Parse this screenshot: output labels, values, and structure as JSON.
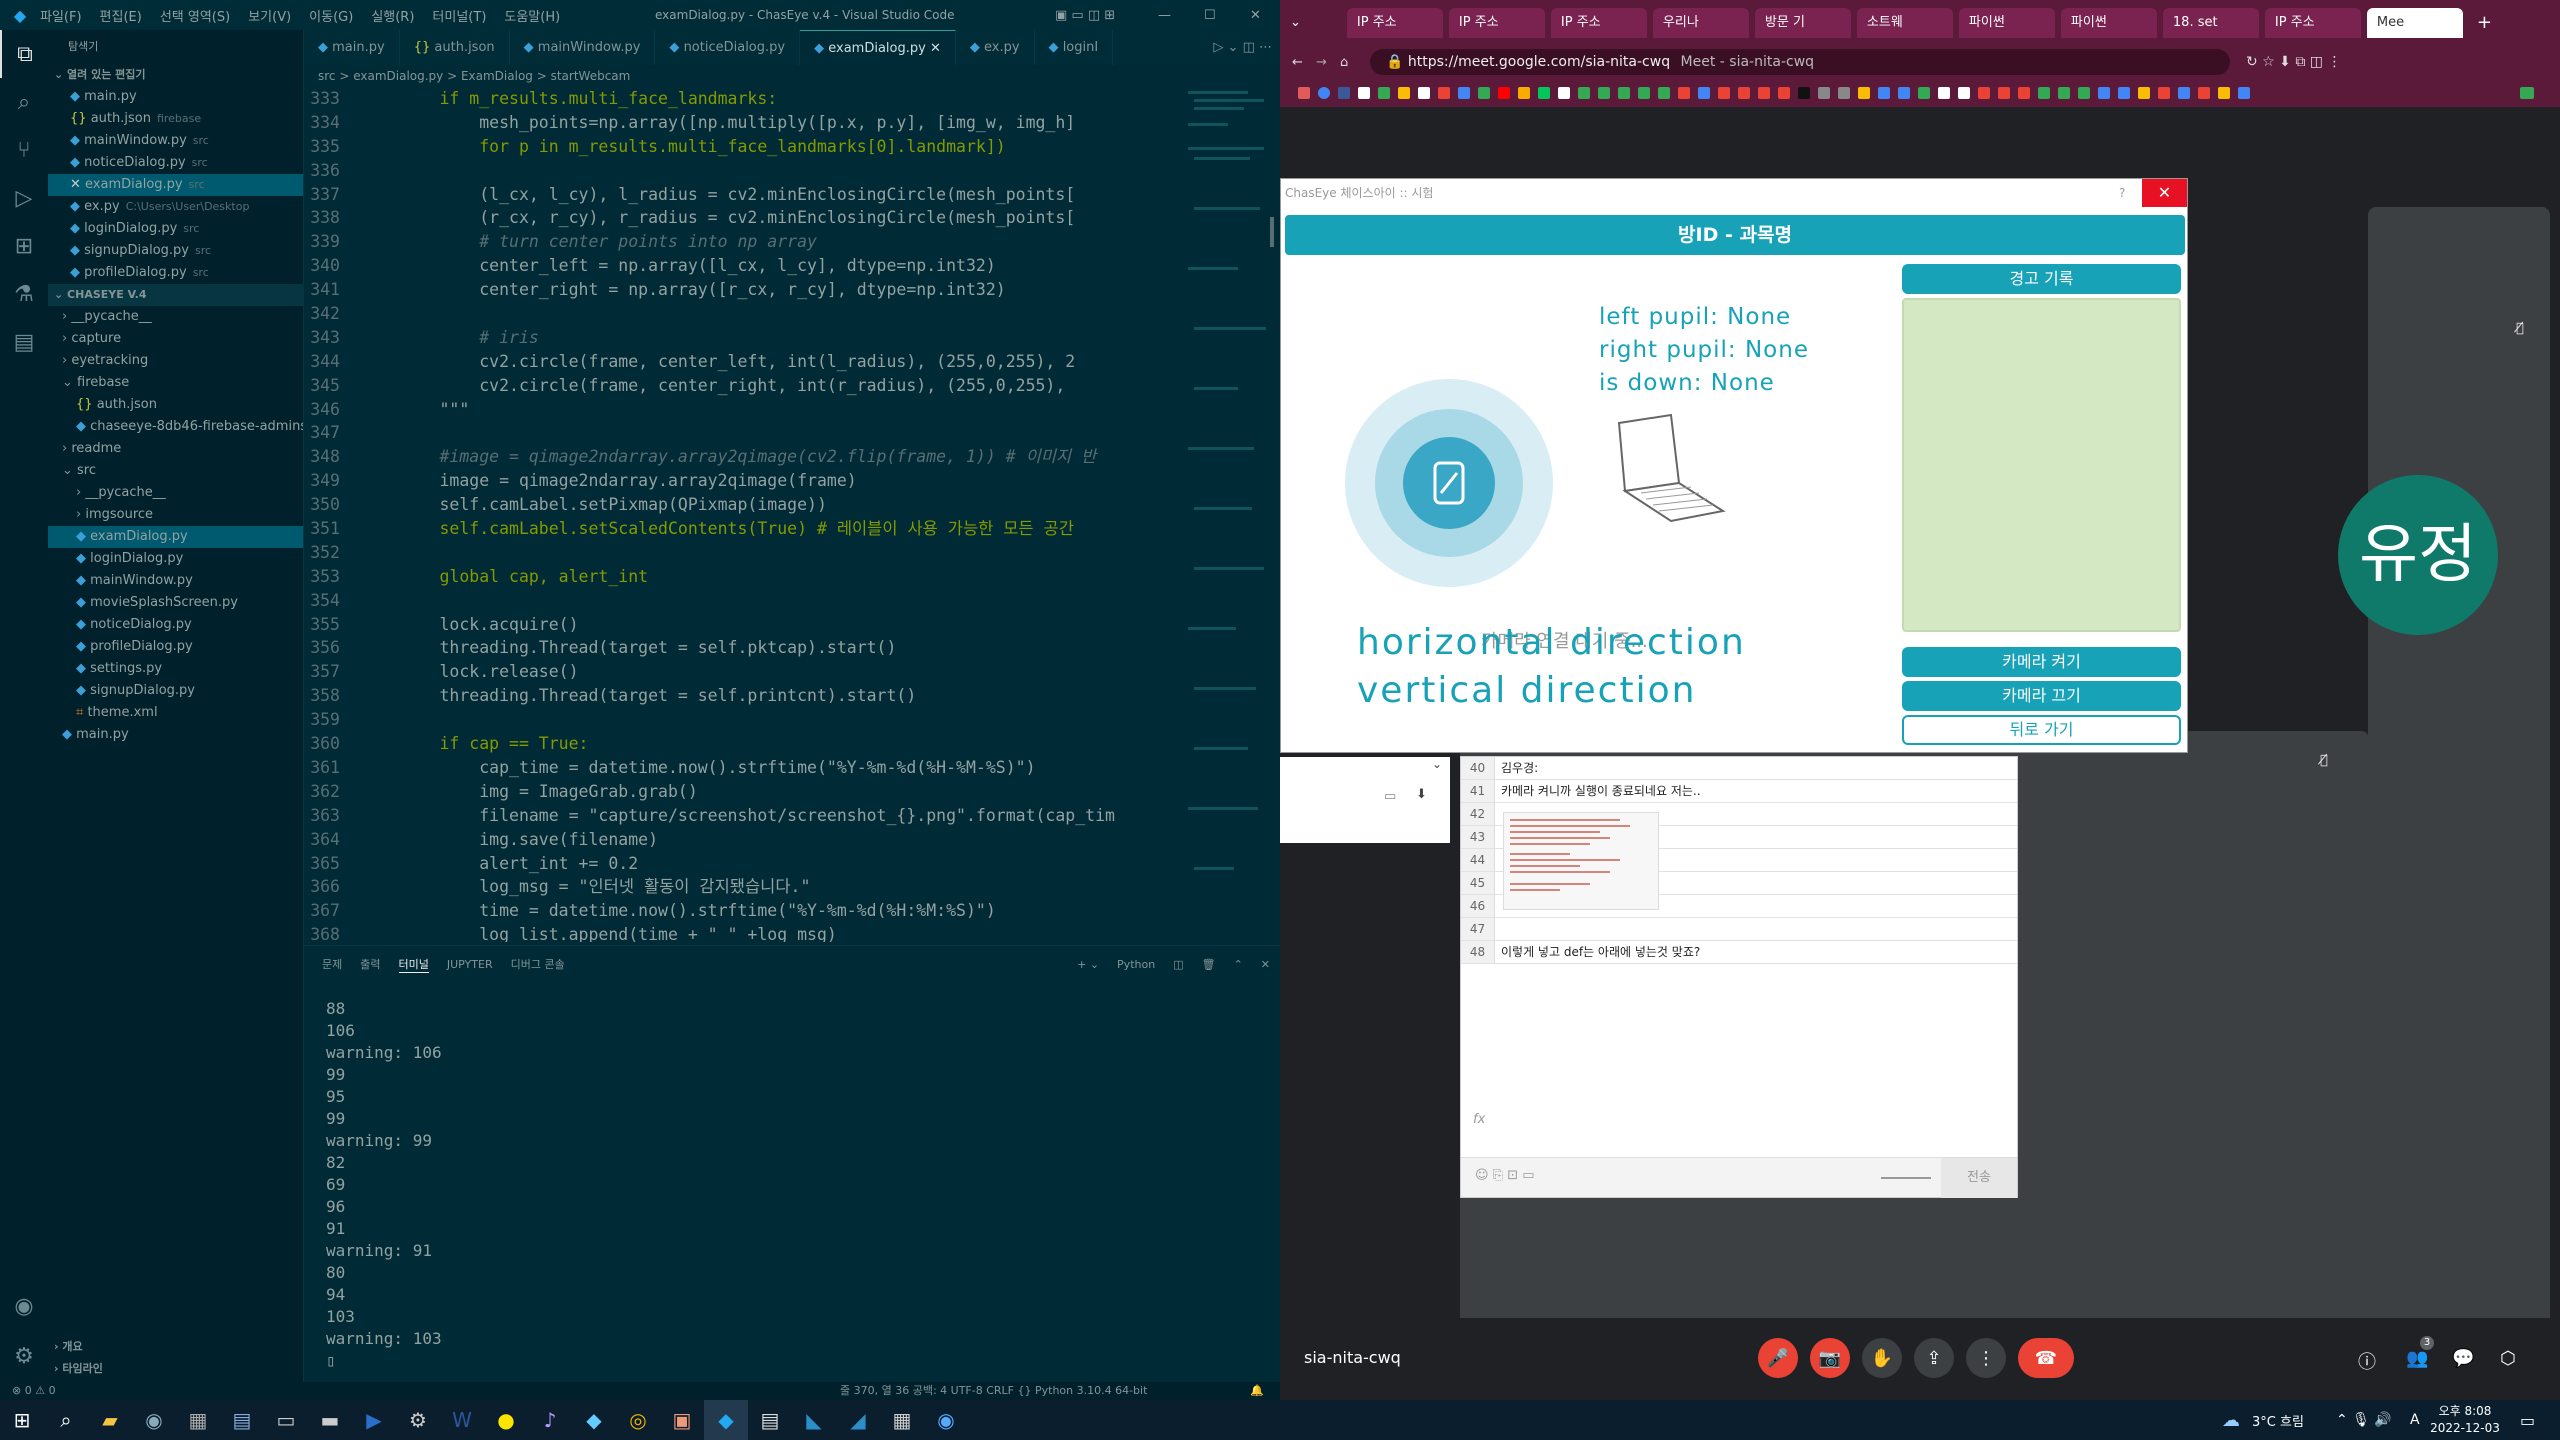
{
  "vscode": {
    "title": "examDialog.py - ChasEye v.4 - Visual Studio Code",
    "menu": [
      "파일(F)",
      "편집(E)",
      "선택 영역(S)",
      "보기(V)",
      "이동(G)",
      "실행(R)",
      "터미널(T)",
      "도움말(H)"
    ],
    "explorer_title": "탐색기",
    "open_editors_label": "열려 있는 편집기",
    "open_editors": [
      {
        "name": "main.py",
        "path": ""
      },
      {
        "name": "auth.json",
        "path": "firebase"
      },
      {
        "name": "mainWindow.py",
        "path": "src"
      },
      {
        "name": "noticeDialog.py",
        "path": "src"
      },
      {
        "name": "examDialog.py",
        "path": "src"
      },
      {
        "name": "ex.py",
        "path": "C:\\Users\\User\\Desktop"
      },
      {
        "name": "loginDialog.py",
        "path": "src"
      },
      {
        "name": "signupDialog.py",
        "path": "src"
      },
      {
        "name": "profileDialog.py",
        "path": "src"
      }
    ],
    "project_label": "CHASEYE V.4",
    "tree": [
      "__pycache__",
      "capture",
      "eyetracking",
      "firebase",
      "auth.json",
      "chaseeye-8db46-firebase-adminsd...",
      "readme",
      "src",
      "__pycache__",
      "imgsource",
      "examDialog.py",
      "loginDialog.py",
      "mainWindow.py",
      "movieSplashScreen.py",
      "noticeDialog.py",
      "profileDialog.py",
      "settings.py",
      "signupDialog.py",
      "theme.xml",
      "main.py"
    ],
    "outline_label": "개요",
    "timeline_label": "타임라인",
    "tabs": [
      "main.py",
      "auth.json",
      "mainWindow.py",
      "noticeDialog.py",
      "examDialog.py",
      "ex.py",
      "loginI"
    ],
    "breadcrumb": "src > examDialog.py > ExamDialog > startWebcam",
    "code": [
      {
        "n": "333",
        "t": "        if m_results.multi_face_landmarks:"
      },
      {
        "n": "334",
        "t": "            mesh_points=np.array([np.multiply([p.x, p.y], [img_w, img_h]"
      },
      {
        "n": "335",
        "t": "            for p in m_results.multi_face_landmarks[0].landmark])"
      },
      {
        "n": "336",
        "t": ""
      },
      {
        "n": "337",
        "t": "            (l_cx, l_cy), l_radius = cv2.minEnclosingCircle(mesh_points["
      },
      {
        "n": "338",
        "t": "            (r_cx, r_cy), r_radius = cv2.minEnclosingCircle(mesh_points["
      },
      {
        "n": "339",
        "t": "            # turn center points into np array"
      },
      {
        "n": "340",
        "t": "            center_left = np.array([l_cx, l_cy], dtype=np.int32)"
      },
      {
        "n": "341",
        "t": "            center_right = np.array([r_cx, r_cy], dtype=np.int32)"
      },
      {
        "n": "342",
        "t": ""
      },
      {
        "n": "343",
        "t": "            # iris"
      },
      {
        "n": "344",
        "t": "            cv2.circle(frame, center_left, int(l_radius), (255,0,255), 2"
      },
      {
        "n": "345",
        "t": "            cv2.circle(frame, center_right, int(r_radius), (255,0,255),"
      },
      {
        "n": "346",
        "t": "        \"\"\""
      },
      {
        "n": "347",
        "t": ""
      },
      {
        "n": "348",
        "t": "        #image = qimage2ndarray.array2qimage(cv2.flip(frame, 1)) # 이미지 반"
      },
      {
        "n": "349",
        "t": "        image = qimage2ndarray.array2qimage(frame)"
      },
      {
        "n": "350",
        "t": "        self.camLabel.setPixmap(QPixmap(image))"
      },
      {
        "n": "351",
        "t": "        self.camLabel.setScaledContents(True) # 레이블이 사용 가능한 모든 공간"
      },
      {
        "n": "352",
        "t": ""
      },
      {
        "n": "353",
        "t": "        global cap, alert_int"
      },
      {
        "n": "354",
        "t": ""
      },
      {
        "n": "355",
        "t": "        lock.acquire()"
      },
      {
        "n": "356",
        "t": "        threading.Thread(target = self.pktcap).start()"
      },
      {
        "n": "357",
        "t": "        lock.release()"
      },
      {
        "n": "358",
        "t": "        threading.Thread(target = self.printcnt).start()"
      },
      {
        "n": "359",
        "t": ""
      },
      {
        "n": "360",
        "t": "        if cap == True:"
      },
      {
        "n": "361",
        "t": "            cap_time = datetime.now().strftime(\"%Y-%m-%d(%H-%M-%S)\")"
      },
      {
        "n": "362",
        "t": "            img = ImageGrab.grab()"
      },
      {
        "n": "363",
        "t": "            filename = \"capture/screenshot/screenshot_{}.png\".format(cap_tim"
      },
      {
        "n": "364",
        "t": "            img.save(filename)"
      },
      {
        "n": "365",
        "t": "            alert_int += 0.2"
      },
      {
        "n": "366",
        "t": "            log_msg = \"인터넷 활동이 감지됐습니다.\""
      },
      {
        "n": "367",
        "t": "            time = datetime.now().strftime(\"%Y-%m-%d(%H:%M:%S)\")"
      },
      {
        "n": "368",
        "t": "            log_list.append(time + \" \" +log_msg)"
      }
    ],
    "panel_tabs": [
      "문제",
      "출력",
      "터미널",
      "JUPYTER",
      "디버그 콘솔"
    ],
    "panel_lang": "Python",
    "terminal": [
      "88",
      "106",
      "warning: 106",
      "99",
      "95",
      "99",
      "warning: 99",
      "82",
      "69",
      "96",
      "91",
      "warning: 91",
      "80",
      "94",
      "103",
      "warning: 103"
    ],
    "status_left": "⊗ 0 ⚠ 0",
    "status_right": "줄 370, 열 36   공백: 4   UTF-8   CRLF   {} Python   3.10.4 64-bit"
  },
  "browser": {
    "tabs": [
      "IP 주소",
      "IP 주소",
      "IP 주소",
      "우리나",
      "방문 기",
      "소트웨",
      "파이썬",
      "파이썬",
      "18. set",
      "IP 주소",
      "Mee"
    ],
    "url": "https://meet.google.com/sia-nita-cwq",
    "page_title": "Meet - sia-nita-cwq"
  },
  "meet": {
    "participant_name": "유정",
    "self_label": "나",
    "meeting_code": "sia-nita-cwq",
    "participants_badge": "3",
    "sheet_rows": [
      {
        "n": "40",
        "t": "김우경:"
      },
      {
        "n": "41",
        "t": "카메라 켜니까 실행이 종료되네요 저는.."
      },
      {
        "n": "42",
        "t": ""
      },
      {
        "n": "43",
        "t": ""
      },
      {
        "n": "44",
        "t": ""
      },
      {
        "n": "45",
        "t": ""
      },
      {
        "n": "46",
        "t": ""
      },
      {
        "n": "47",
        "t": ""
      },
      {
        "n": "48",
        "t": "이렇게 넣고 def는 아래에 넣는것 맞죠?"
      }
    ],
    "sheet_fx": "fx",
    "sheet_send": "전송"
  },
  "dialog": {
    "title": "ChasEye 체이스아이 :: 시험",
    "help": "?",
    "header": "방ID - 과목명",
    "pupil_left": "left pupil:  None",
    "pupil_right": "right pupil: None",
    "is_down": "is down: None",
    "horizontal": "horizontal direction",
    "vertical": "vertical direction",
    "overlay_text": "카메라 연결 대기 중...",
    "log_button": "경고 기록",
    "camera_on": "카메라 켜기",
    "camera_off": "카메라 끄기",
    "back": "뒤로 가기"
  },
  "taskbar": {
    "weather": "3°C  흐림",
    "time": "오후 8:08",
    "date": "2022-12-03",
    "ime": "A"
  },
  "colors": {
    "accent": "#17a2b8",
    "log_bg": "#d4e8c3",
    "meet_red": "#ea4335",
    "avatar": "#0f7a6a"
  }
}
